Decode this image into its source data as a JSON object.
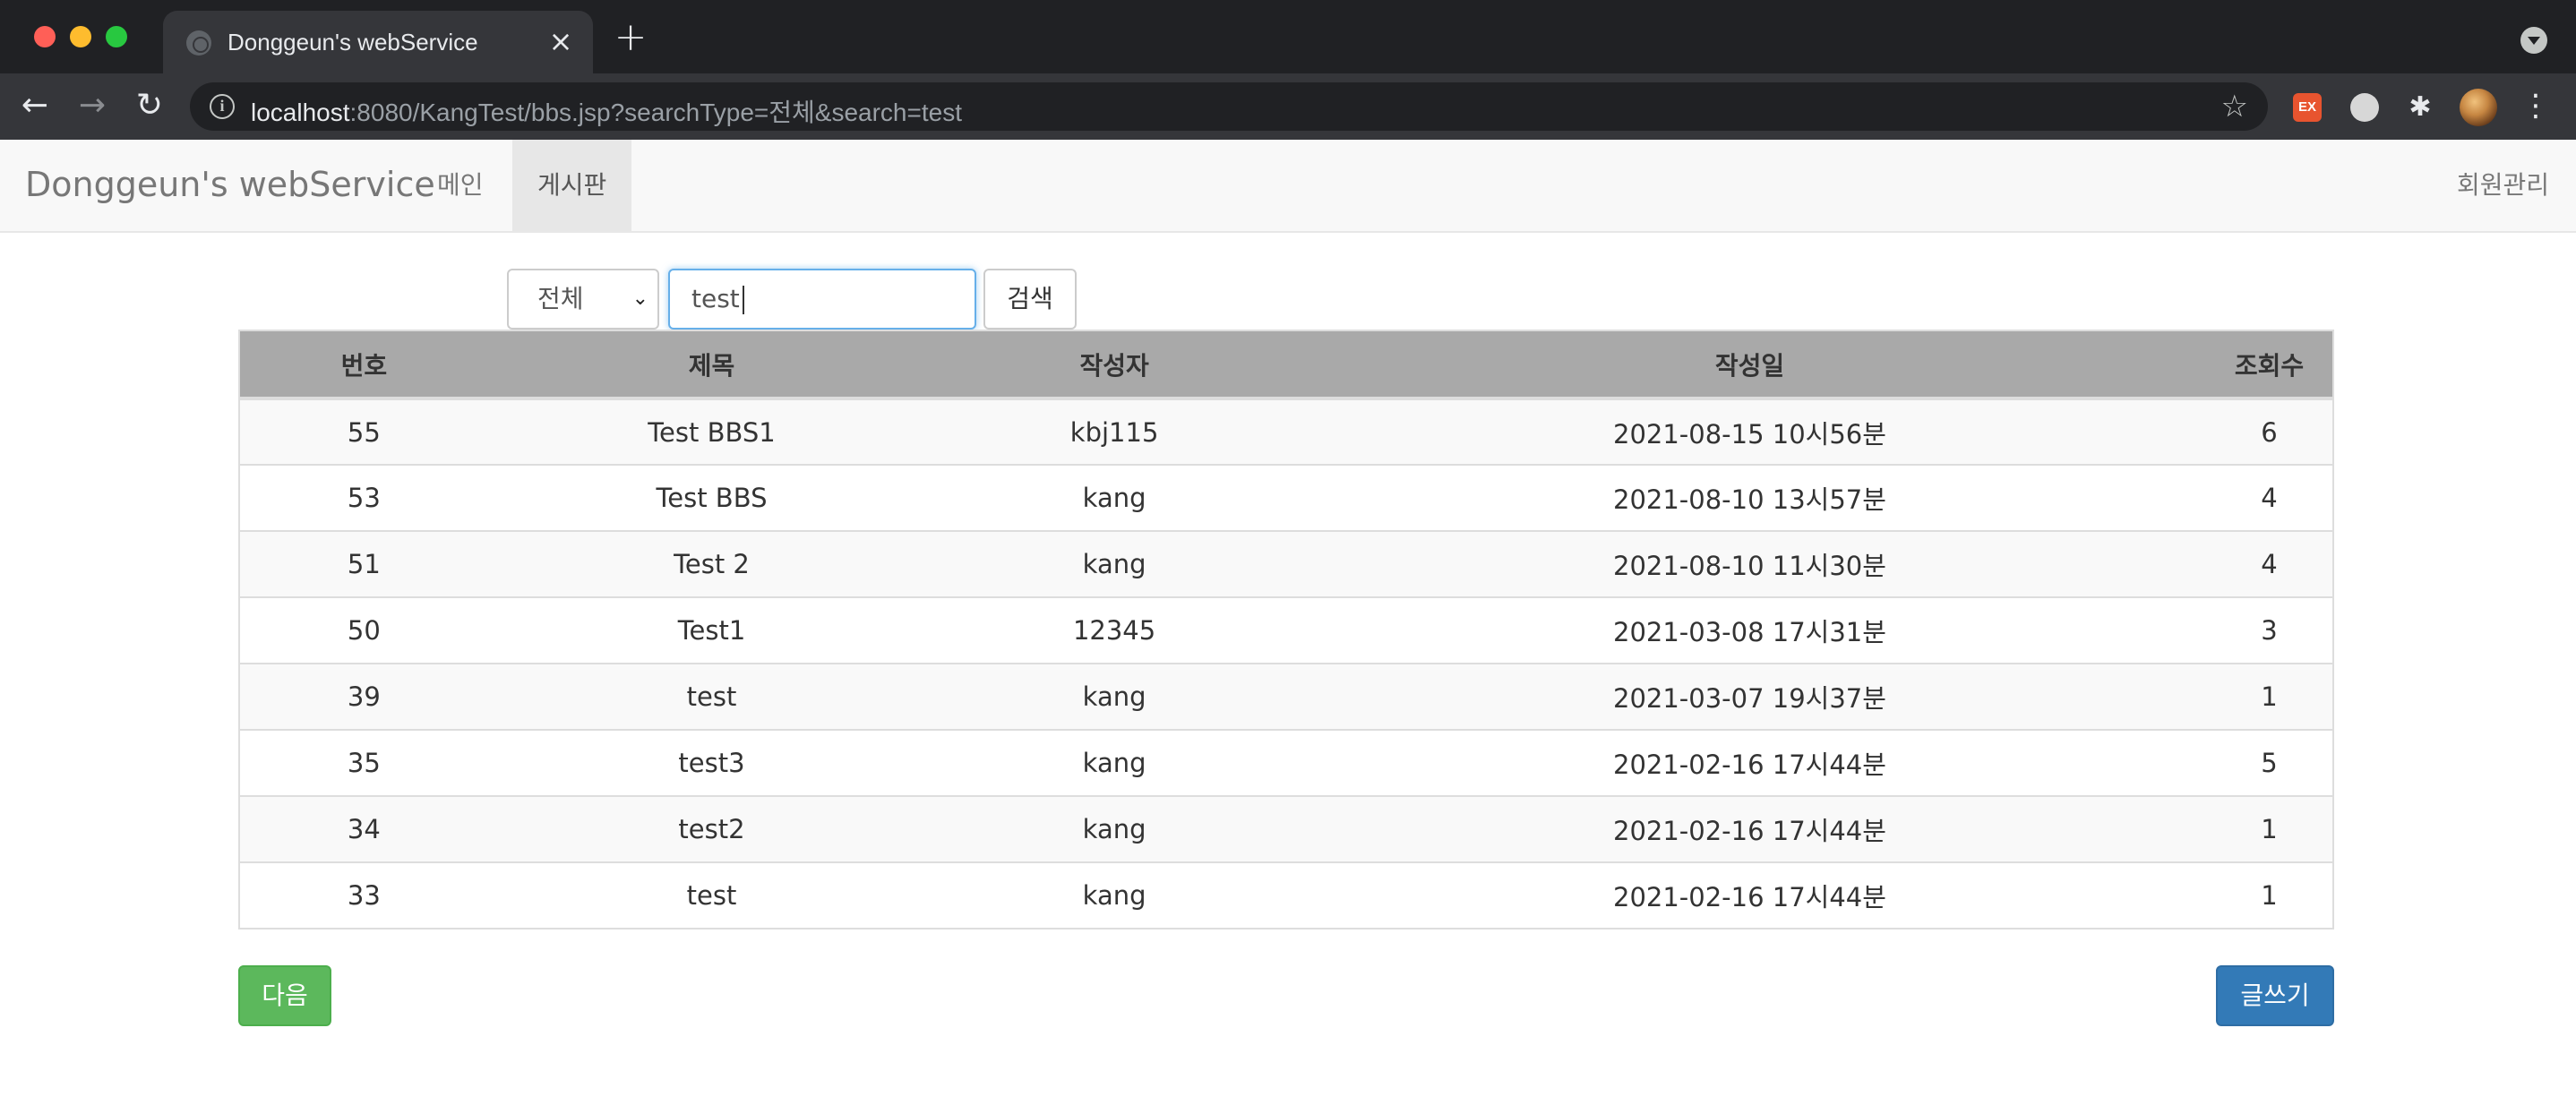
{
  "browser": {
    "tab_title": "Donggeun's webService",
    "url_host": "localhost",
    "url_path": ":8080/KangTest/bbs.jsp?searchType=전체&search=test",
    "ext_label": "EX"
  },
  "navbar": {
    "brand": "Donggeun's webService",
    "items": [
      {
        "label": "메인",
        "active": false
      },
      {
        "label": "게시판",
        "active": true
      }
    ],
    "right_item": "회원관리"
  },
  "search": {
    "type_selected": "전체",
    "query_value": "test",
    "button_label": "검색"
  },
  "table": {
    "headers": [
      "번호",
      "제목",
      "작성자",
      "작성일",
      "조회수"
    ],
    "rows": [
      [
        "55",
        "Test BBS1",
        "kbj115",
        "2021-08-15 10시56분",
        "6"
      ],
      [
        "53",
        "Test BBS",
        "kang",
        "2021-08-10 13시57분",
        "4"
      ],
      [
        "51",
        "Test 2",
        "kang",
        "2021-08-10 11시30분",
        "4"
      ],
      [
        "50",
        "Test1",
        "12345",
        "2021-03-08 17시31분",
        "3"
      ],
      [
        "39",
        "test",
        "kang",
        "2021-03-07 19시37분",
        "1"
      ],
      [
        "35",
        "test3",
        "kang",
        "2021-02-16 17시44분",
        "5"
      ],
      [
        "34",
        "test2",
        "kang",
        "2021-02-16 17시44분",
        "1"
      ],
      [
        "33",
        "test",
        "kang",
        "2021-02-16 17시44분",
        "1"
      ]
    ]
  },
  "buttons": {
    "next_label": "다음",
    "write_label": "글쓰기"
  },
  "colors": {
    "next_button": "#5cb85c",
    "write_button": "#337ab7",
    "table_header": "#a9a9a9"
  }
}
